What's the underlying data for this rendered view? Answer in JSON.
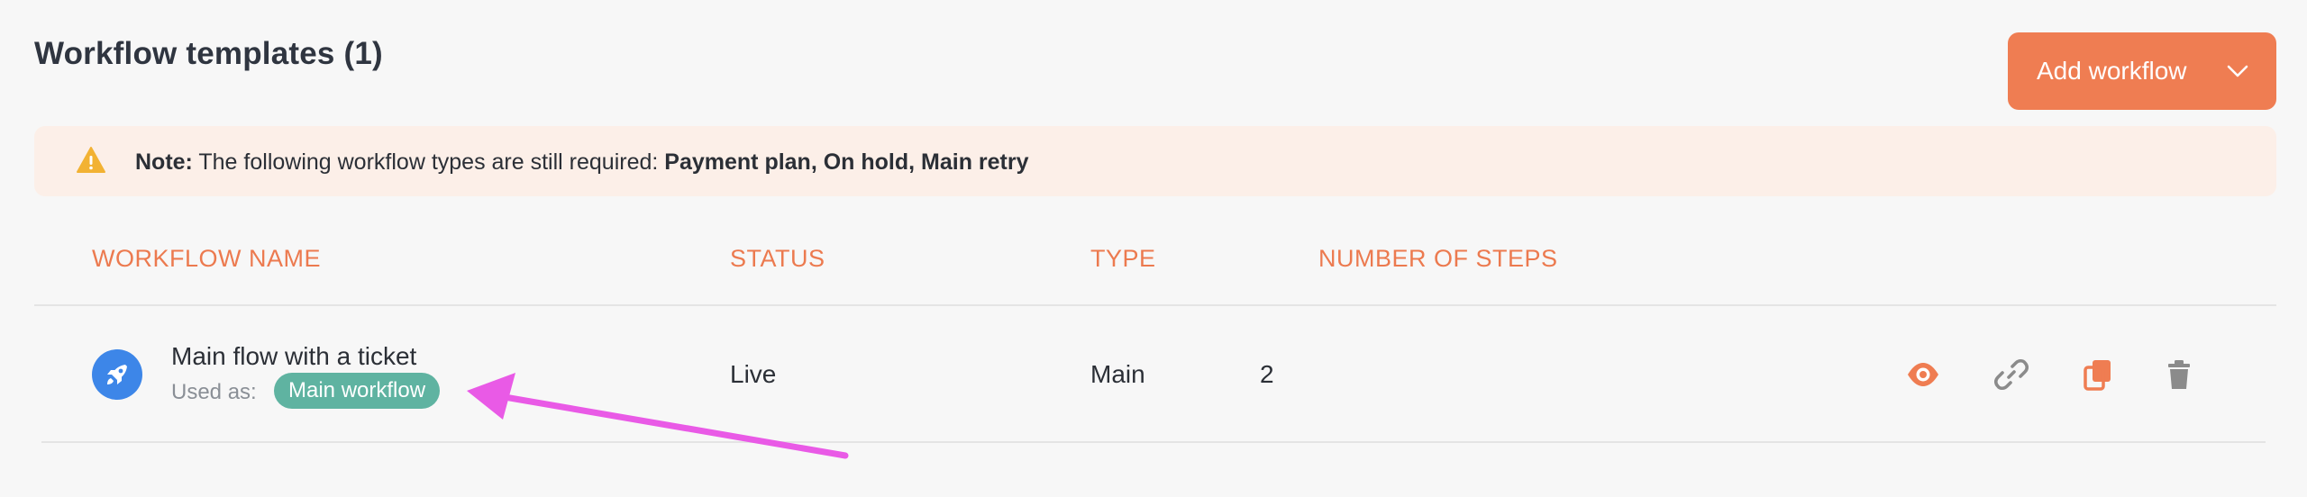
{
  "header": {
    "title": "Workflow templates (1)",
    "add_button_label": "Add workflow",
    "add_button_icon": "chevron-down-icon"
  },
  "note": {
    "prefix": "Note:",
    "message": " The following workflow types are still required: ",
    "required_types": "Payment plan, On hold, Main retry",
    "icon": "warning-icon"
  },
  "table": {
    "columns": [
      "WORKFLOW NAME",
      "STATUS",
      "TYPE",
      "NUMBER OF STEPS"
    ],
    "rows": [
      {
        "name": "Main flow with a ticket",
        "used_as_label": "Used as:",
        "used_as_badge": "Main workflow",
        "status": "Live",
        "type": "Main",
        "steps": "2",
        "icon": "rocket-icon"
      }
    ],
    "actions": [
      "view-icon",
      "link-icon",
      "copy-icon",
      "delete-icon"
    ]
  },
  "colors": {
    "accent": "#ef7d52",
    "header_text": "#ec7a4f",
    "note_bg": "#fcefe8",
    "badge": "#5fb3a1",
    "avatar": "#3d86e8",
    "annotation_arrow": "#e95ae6"
  }
}
